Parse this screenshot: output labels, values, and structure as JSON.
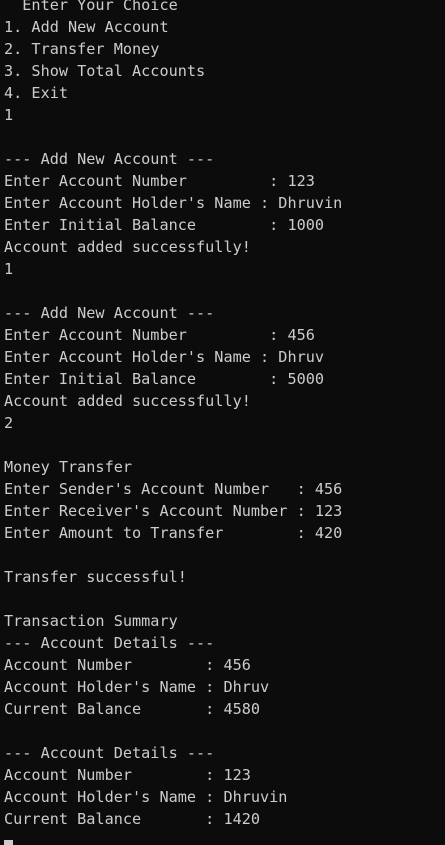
{
  "terminal": {
    "lines": [
      "  Enter Your Choice",
      "1. Add New Account",
      "2. Transfer Money",
      "3. Show Total Accounts",
      "4. Exit",
      "1",
      "",
      "--- Add New Account ---",
      "Enter Account Number         : 123",
      "Enter Account Holder's Name : Dhruvin",
      "Enter Initial Balance        : 1000",
      "Account added successfully!",
      "1",
      "",
      "--- Add New Account ---",
      "Enter Account Number         : 456",
      "Enter Account Holder's Name : Dhruv",
      "Enter Initial Balance        : 5000",
      "Account added successfully!",
      "2",
      "",
      "Money Transfer",
      "Enter Sender's Account Number   : 456",
      "Enter Receiver's Account Number : 123",
      "Enter Amount to Transfer        : 420",
      "",
      "Transfer successful!",
      "",
      "Transaction Summary",
      "--- Account Details ---",
      "Account Number        : 456",
      "Account Holder's Name : Dhruv",
      "Current Balance       : 4580",
      "",
      "--- Account Details ---",
      "Account Number        : 123",
      "Account Holder's Name : Dhruvin",
      "Current Balance       : 1420"
    ]
  },
  "colors": {
    "background": "#0c0c0c",
    "foreground": "#cccccc"
  }
}
